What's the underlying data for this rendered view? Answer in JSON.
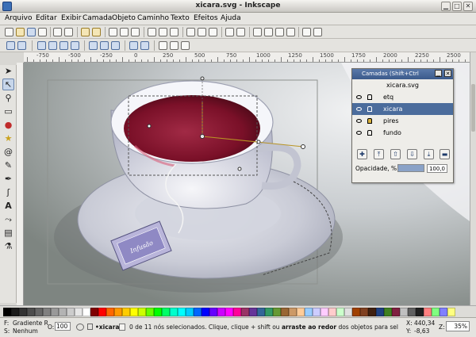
{
  "window": {
    "title": "xicara.svg - Inkscape"
  },
  "menu": [
    "Arquivo",
    "Editar",
    "Exibir",
    "Camada",
    "Objeto",
    "Caminho",
    "Texto",
    "Efeitos",
    "Ajuda"
  ],
  "ruler": {
    "h_labels": [
      "-750",
      "-500",
      "-250",
      "0",
      "250",
      "500",
      "750",
      "1000",
      "1250",
      "1500",
      "1750",
      "2000",
      "2250",
      "2500"
    ]
  },
  "colors": {
    "accent": "#4b6c9c",
    "tea": "#7a1028"
  },
  "layers": {
    "title": "Camadas (Shift+Ctrl",
    "document": "xicara.svg",
    "items": [
      {
        "name": "etq",
        "selected": false
      },
      {
        "name": "xicara",
        "selected": true
      },
      {
        "name": "pires",
        "selected": false
      },
      {
        "name": "fundo",
        "selected": false
      }
    ],
    "opacity_label": "Opacidade, %:",
    "opacity_value": "100,0",
    "opacity_fraction": 1.0
  },
  "status": {
    "fill_label": "F:",
    "fill_value": "Gradiente R",
    "stroke_label": "S:",
    "stroke_value": "Nenhum",
    "opacity_label": "O:",
    "opacity_value": "100",
    "layer_value": "•xicara",
    "message_a": "0 de 11 nós selecionados. Clique, clique + shift ou ",
    "message_b": "arraste ao redor",
    "message_c": " dos objetos para sel",
    "x_label": "X:",
    "x_value": "440,34",
    "y_label": "Y:",
    "y_value": "-8,63",
    "zoom_label": "Z:",
    "zoom_value": "35%"
  },
  "tea_tag": {
    "text": "Infusão"
  }
}
